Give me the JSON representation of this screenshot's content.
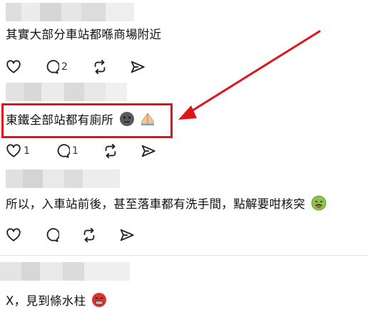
{
  "posts": [
    {
      "text": "其實大部分車站都喺商場附近",
      "like_count": "",
      "reply_count": "2",
      "repost_count": "",
      "emoji": []
    },
    {
      "text": "東鐵全部站都有廁所",
      "like_count": "1",
      "reply_count": "1",
      "repost_count": "",
      "emoji": [
        "neutral-face-emoji",
        "folded-hands-emoji"
      ]
    },
    {
      "text": "所以，入車站前後，甚至落車都有洗手間，點解要咁核突",
      "like_count": "",
      "reply_count": "",
      "repost_count": "",
      "emoji": [
        "nauseated-face-emoji"
      ]
    },
    {
      "text": "X，見到條水柱",
      "like_count": "",
      "reply_count": "",
      "repost_count": "",
      "emoji": [
        "angry-face-emoji"
      ]
    }
  ],
  "annotation": {
    "color": "#e0151c"
  },
  "icons": [
    "heart-icon",
    "comment-icon",
    "repost-icon",
    "share-icon"
  ]
}
